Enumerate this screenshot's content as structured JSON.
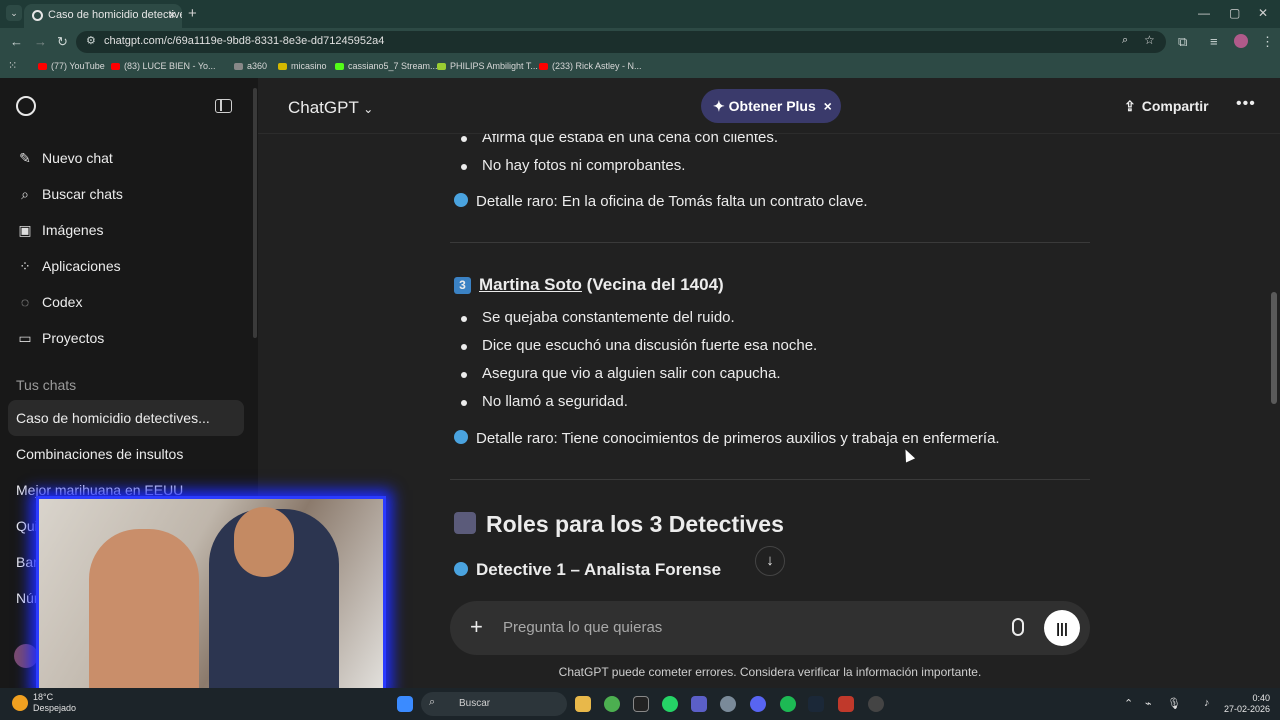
{
  "browser": {
    "tab_title": "Caso de homicidio detectivesco",
    "url": "chatgpt.com/c/69a1119e-9bd8-8331-8e3e-dd71245952a4",
    "bookmarks": [
      {
        "label": "(77) YouTube",
        "color": "#ff0000"
      },
      {
        "label": "(83) LUCE BIEN - Yo...",
        "color": "#ff0000"
      },
      {
        "label": "a360",
        "color": "#888888"
      },
      {
        "label": "micasino",
        "color": "#d4b800"
      },
      {
        "label": "cassiano5_7 Stream...",
        "color": "#53fc18"
      },
      {
        "label": "PHILIPS Ambilight T...",
        "color": "#9acd32"
      },
      {
        "label": "(233) Rick Astley - N...",
        "color": "#ff0000"
      }
    ]
  },
  "sidebar": {
    "items": [
      {
        "label": "Nuevo chat",
        "icon": "✎"
      },
      {
        "label": "Buscar chats",
        "icon": "⌕"
      },
      {
        "label": "Imágenes",
        "icon": "▣"
      },
      {
        "label": "Aplicaciones",
        "icon": "⁘"
      },
      {
        "label": "Codex",
        "icon": "◌"
      },
      {
        "label": "Proyectos",
        "icon": "▭"
      }
    ],
    "section_title": "Tus chats",
    "chats": [
      "Caso de homicidio detectives...",
      "Combinaciones de insultos",
      "Mejor marihuana en EEUU",
      "Qui",
      "Ban",
      "Nún"
    ]
  },
  "header": {
    "model": "ChatGPT",
    "plus_label": "Obtener Plus",
    "share_label": "Compartir"
  },
  "content": {
    "top_bullets": [
      "Afirma que estaba en una cena con clientes.",
      "No hay fotos ni comprobantes."
    ],
    "detail1": "Detalle raro: En la oficina de Tomás falta un contrato clave.",
    "section3_name": "Martina Soto",
    "section3_rest": " (Vecina del 1404)",
    "section3_num": "3",
    "section3_bullets": [
      "Se quejaba constantemente del ruido.",
      "Dice que escuchó una discusión fuerte esa noche.",
      "Asegura que vio a alguien salir con capucha.",
      "No llamó a seguridad."
    ],
    "detail2": "Detalle raro: Tiene conocimientos de primeros auxilios y trabaja en enfermería.",
    "roles_heading": "Roles para los 3 Detectives",
    "detective1_heading": "Detective 1 – Analista Forense"
  },
  "composer": {
    "placeholder": "Pregunta lo que quieras",
    "disclaimer": "ChatGPT puede cometer errores. Considera verificar la información importante."
  },
  "taskbar": {
    "temp": "18°C",
    "weather": "Despejado",
    "search": "Buscar",
    "time": "0:40",
    "date": "27-02-2026"
  },
  "colors": {
    "accent_plus": "#3a3a6b",
    "webcam_border": "#2a3bff"
  }
}
